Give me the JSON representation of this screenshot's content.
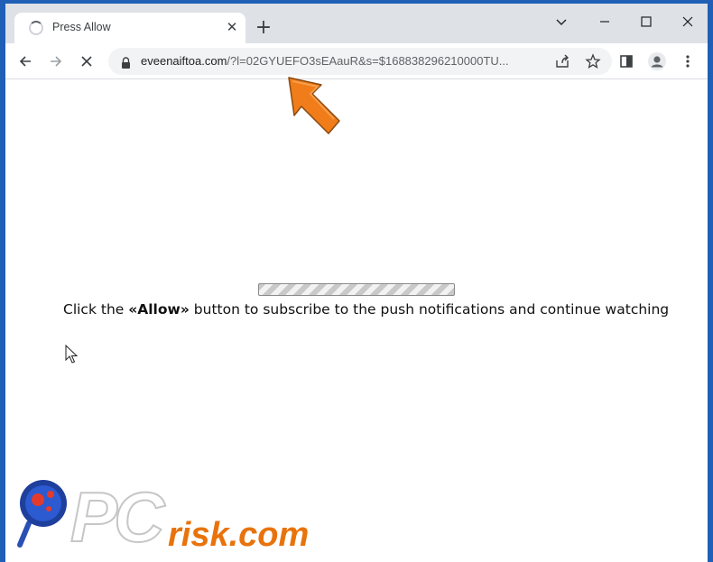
{
  "tab": {
    "title": "Press Allow",
    "close": "✕"
  },
  "newtab": "+",
  "address": {
    "url_host": "eveenaiftoa.com",
    "url_rest": "/?l=02GYUEFO3sEAauR&s=$168838296210000TU..."
  },
  "page": {
    "message_before": "Click the ",
    "message_bold": "«Allow»",
    "message_after": " button to subscribe to the push notifications and continue watching",
    "progress_note": "loading"
  },
  "watermark": {
    "brand": "risk.com",
    "prefix": "PC"
  },
  "colors": {
    "accent": "#1f5fb5",
    "arrow": "#f07d1a",
    "watermark": "#e8730c"
  }
}
